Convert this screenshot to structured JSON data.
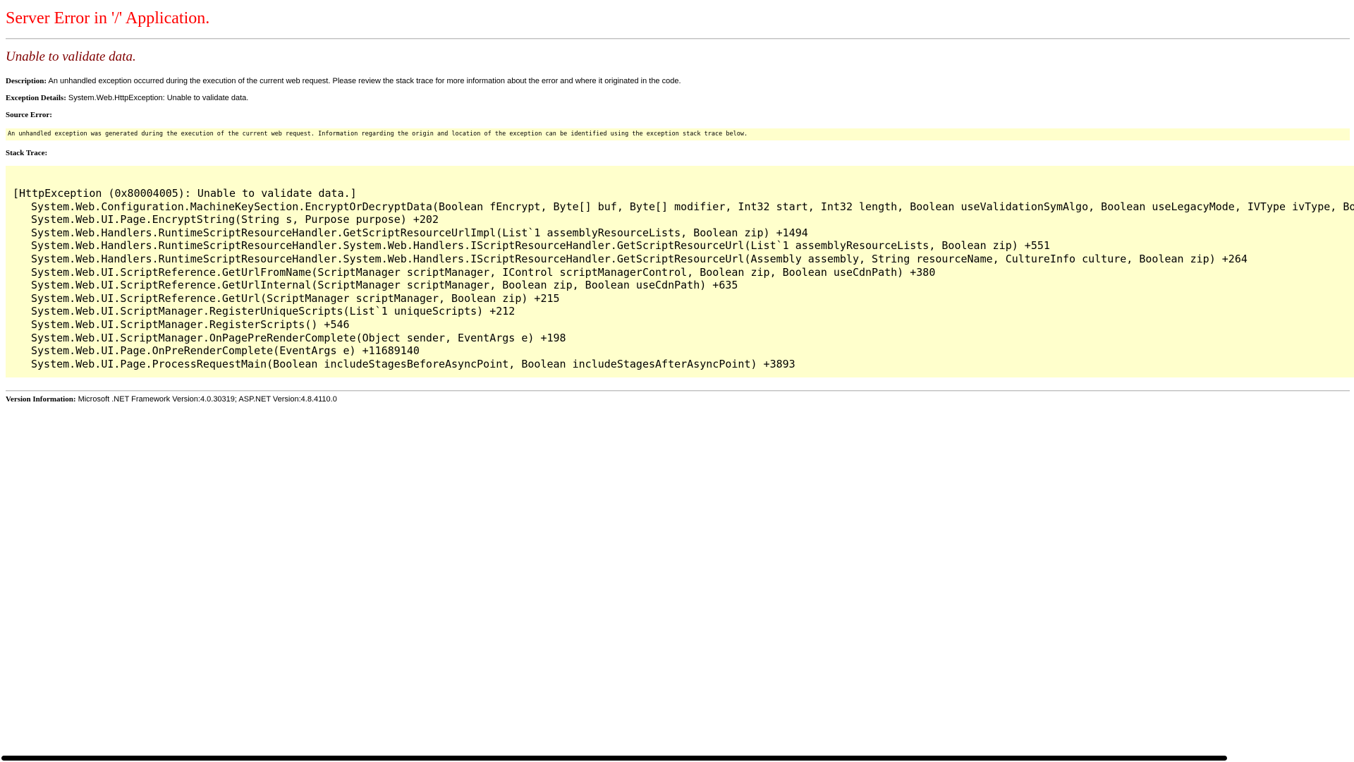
{
  "page": {
    "title": "Server Error in '/' Application.",
    "subtitle": "Unable to validate data."
  },
  "description": {
    "label": "Description:",
    "text": " An unhandled exception occurred during the execution of the current web request. Please review the stack trace for more information about the error and where it originated in the code."
  },
  "exception_details": {
    "label": "Exception Details:",
    "text": " System.Web.HttpException: Unable to validate data."
  },
  "source_error": {
    "label": "Source Error:",
    "text": "An unhandled exception was generated during the execution of the current web request. Information regarding the origin and location of the exception can be identified using the exception stack trace below."
  },
  "stack_trace": {
    "label": "Stack Trace:",
    "header": "[HttpException (0x80004005): Unable to validate data.]",
    "frames": [
      "System.Web.Configuration.MachineKeySection.EncryptOrDecryptData(Boolean fEncrypt, Byte[] buf, Byte[] modifier, Int32 start, Int32 length, Boolean useValidationSymAlgo, Boolean useLegacyMode, IVType ivType, Boo",
      "System.Web.UI.Page.EncryptString(String s, Purpose purpose) +202",
      "System.Web.Handlers.RuntimeScriptResourceHandler.GetScriptResourceUrlImpl(List`1 assemblyResourceLists, Boolean zip) +1494",
      "System.Web.Handlers.RuntimeScriptResourceHandler.System.Web.Handlers.IScriptResourceHandler.GetScriptResourceUrl(List`1 assemblyResourceLists, Boolean zip) +551",
      "System.Web.Handlers.RuntimeScriptResourceHandler.System.Web.Handlers.IScriptResourceHandler.GetScriptResourceUrl(Assembly assembly, String resourceName, CultureInfo culture, Boolean zip) +264",
      "System.Web.UI.ScriptReference.GetUrlFromName(ScriptManager scriptManager, IControl scriptManagerControl, Boolean zip, Boolean useCdnPath) +380",
      "System.Web.UI.ScriptReference.GetUrlInternal(ScriptManager scriptManager, Boolean zip, Boolean useCdnPath) +635",
      "System.Web.UI.ScriptReference.GetUrl(ScriptManager scriptManager, Boolean zip) +215",
      "System.Web.UI.ScriptManager.RegisterUniqueScripts(List`1 uniqueScripts) +212",
      "System.Web.UI.ScriptManager.RegisterScripts() +546",
      "System.Web.UI.ScriptManager.OnPagePreRenderComplete(Object sender, EventArgs e) +198",
      "System.Web.UI.Page.OnPreRenderComplete(EventArgs e) +11689140",
      "System.Web.UI.Page.ProcessRequestMain(Boolean includeStagesBeforeAsyncPoint, Boolean includeStagesAfterAsyncPoint) +3893"
    ]
  },
  "version_information": {
    "label": "Version Information:",
    "text": " Microsoft .NET Framework Version:4.0.30319; ASP.NET Version:4.8.4110.0"
  },
  "colors": {
    "title": "#ff0000",
    "subtitle": "#800000",
    "code_background": "#ffffcc",
    "rule": "#c0c0c0"
  }
}
